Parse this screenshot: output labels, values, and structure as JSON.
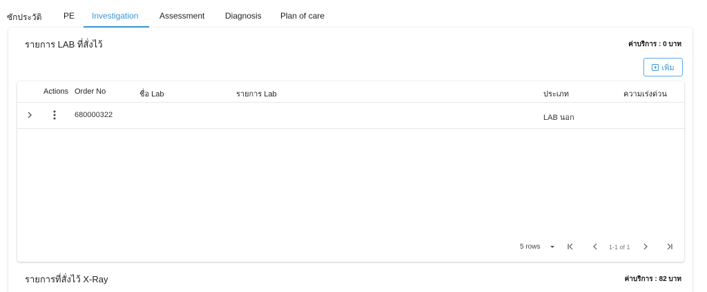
{
  "tabs": [
    {
      "label": "ซักประวัติ"
    },
    {
      "label": "PE"
    },
    {
      "label": "Investigation"
    },
    {
      "label": "Assessment"
    },
    {
      "label": "Diagnosis"
    },
    {
      "label": "Plan of care"
    }
  ],
  "active_tab": "Investigation",
  "lab_section": {
    "title": "รายการ LAB ที่สั่งไว้",
    "fee": "ค่าบริการ : 0 บาท",
    "add_label": "เพิ่ม",
    "columns": [
      "Actions",
      "Order No",
      "ชื่อ Lab",
      "รายการ Lab",
      "ประเภท",
      "ความเร่งด่วน"
    ],
    "rows": [
      {
        "order_no": "680000322",
        "lab_name": "",
        "lab_items": "",
        "type": "LAB นอก",
        "urgency": ""
      }
    ],
    "pagination": {
      "rows_per_page": "5 rows",
      "range": "1-1 of 1"
    }
  },
  "xray_section": {
    "title": "รายการที่สั่งไว้ X-Ray",
    "fee": "ค่าบริการ : 82 บาท"
  },
  "colors": {
    "accent": "#3b95d8",
    "text": "#1f1f1f",
    "divider": "#e6e6e6"
  }
}
